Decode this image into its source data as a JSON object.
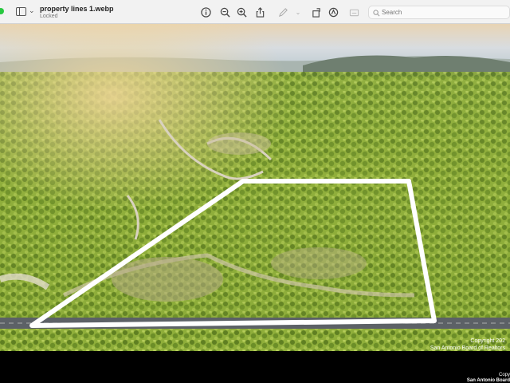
{
  "window": {
    "title": "property lines 1.webp",
    "subtitle": "Locked"
  },
  "toolbar": {
    "icons": [
      "sidebar-icon",
      "chevron-down-icon",
      "info-icon",
      "zoom-out-icon",
      "zoom-in-icon",
      "share-icon",
      "markup-pen-icon",
      "chevron-down-icon",
      "rotate-icon",
      "markup-circle-icon",
      "annotate-icon"
    ],
    "search_placeholder": "Search"
  },
  "image": {
    "watermark_line1": "Copyright 202",
    "watermark_line2": "San Antonio Board of Realtors",
    "footer_line1": "Copy",
    "footer_line2": "San Antonio Board",
    "boundary_color": "#ffffff"
  }
}
